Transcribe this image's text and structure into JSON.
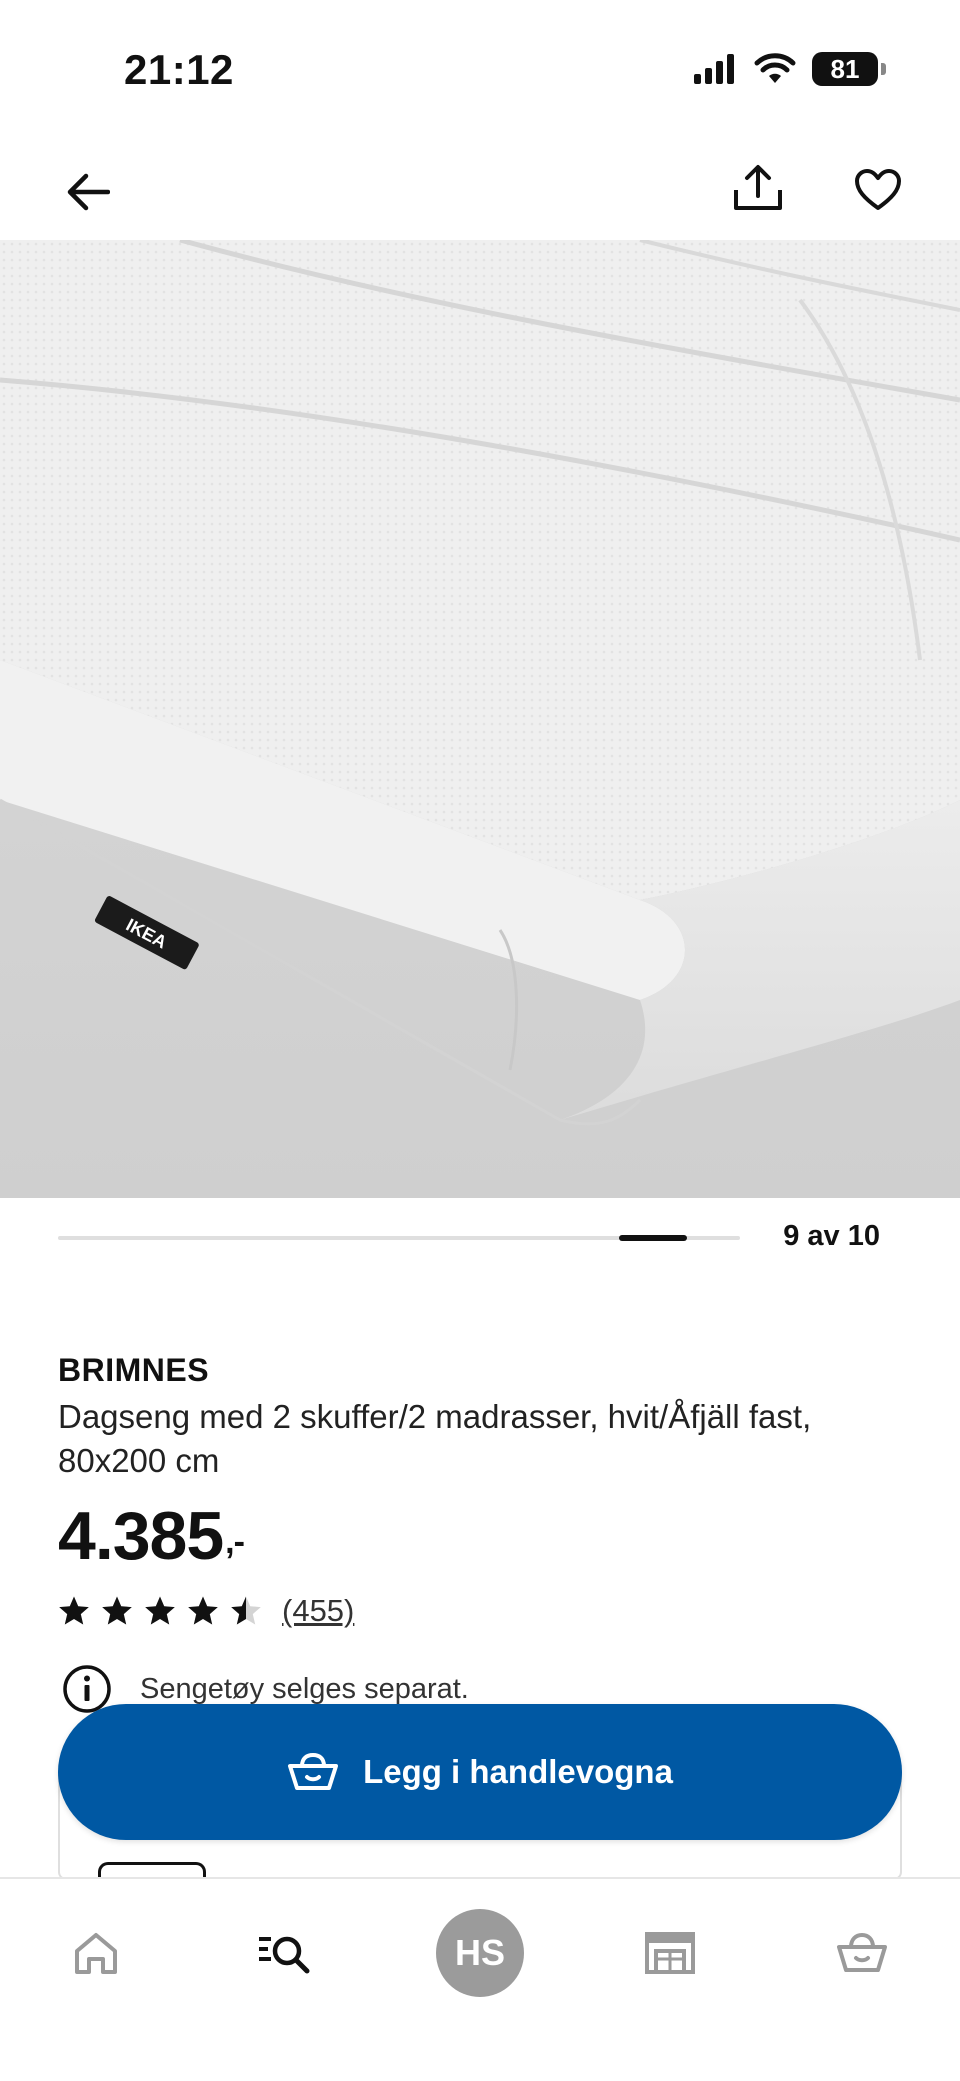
{
  "status_bar": {
    "time": "21:12",
    "battery": "81"
  },
  "top_bar": {
    "back_icon": "arrow-left-icon",
    "share_icon": "share-icon",
    "favorite_icon": "heart-icon"
  },
  "carousel": {
    "counter": "9 av 10",
    "current": 9,
    "total": 10
  },
  "product": {
    "brand": "BRIMNES",
    "description": "Dagseng med 2 skuffer/2 madrasser, hvit/Åfjäll fast, 80x200 cm",
    "price": "4.385",
    "price_suffix": ",-",
    "rating": 4.5,
    "rating_max": 5,
    "review_count": "(455)",
    "image_label": "IKEA"
  },
  "notice": {
    "text": "Sengetøy selges separat.",
    "icon": "info-icon"
  },
  "cta": {
    "label": "Legg i handlevogna",
    "icon": "basket-icon"
  },
  "bottom_nav": {
    "items": [
      {
        "id": "home",
        "icon": "home-icon"
      },
      {
        "id": "search",
        "icon": "search-list-icon"
      },
      {
        "id": "profile",
        "label": "HS"
      },
      {
        "id": "store",
        "icon": "store-icon"
      },
      {
        "id": "cart",
        "icon": "basket-icon"
      }
    ]
  },
  "colors": {
    "accent": "#0058a3",
    "text": "#111111",
    "avatar": "#9b9b9b"
  }
}
